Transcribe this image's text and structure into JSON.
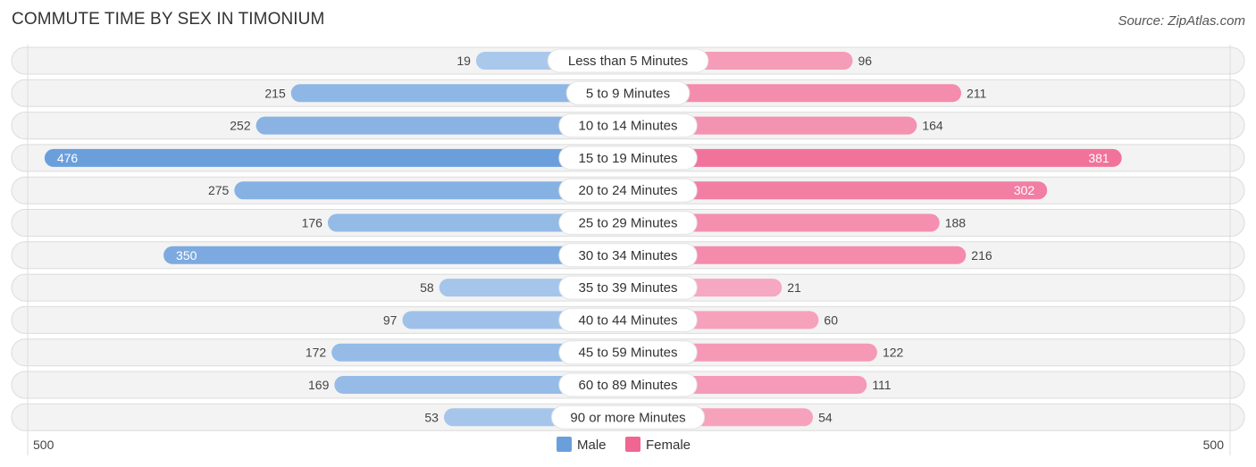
{
  "chart_data": {
    "type": "bar",
    "orientation": "horizontal-diverging",
    "title": "COMMUTE TIME BY SEX IN TIMONIUM",
    "source": "Source: ZipAtlas.com",
    "categories": [
      "Less than 5 Minutes",
      "5 to 9 Minutes",
      "10 to 14 Minutes",
      "15 to 19 Minutes",
      "20 to 24 Minutes",
      "25 to 29 Minutes",
      "30 to 34 Minutes",
      "35 to 39 Minutes",
      "40 to 44 Minutes",
      "45 to 59 Minutes",
      "60 to 89 Minutes",
      "90 or more Minutes"
    ],
    "series": [
      {
        "name": "Male",
        "side": "left",
        "color": "#6a9fdc",
        "values": [
          19,
          215,
          252,
          476,
          275,
          176,
          350,
          58,
          97,
          172,
          169,
          53
        ]
      },
      {
        "name": "Female",
        "side": "right",
        "color": "#f06592",
        "values": [
          96,
          211,
          164,
          381,
          302,
          188,
          216,
          21,
          60,
          122,
          111,
          54
        ]
      }
    ],
    "axis": {
      "left_label": "500",
      "right_label": "500",
      "max": 500
    },
    "legend": {
      "placement": "bottom-center",
      "entries": [
        "Male",
        "Female"
      ]
    },
    "grid": false
  }
}
